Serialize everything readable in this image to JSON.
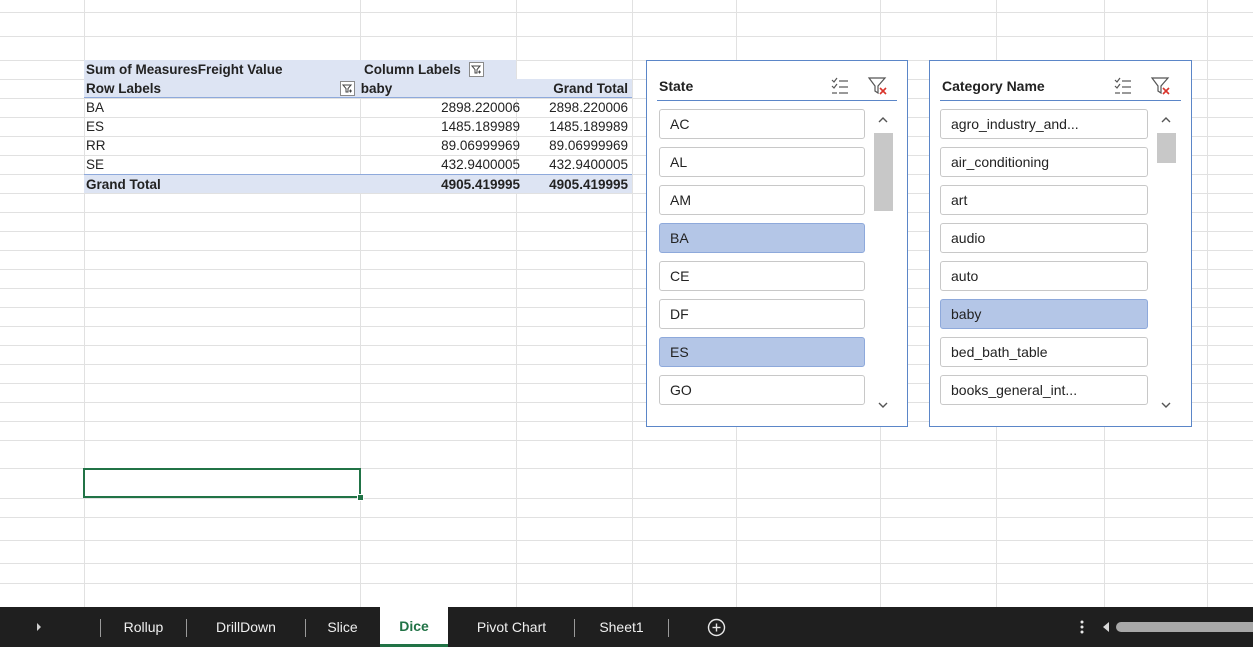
{
  "pivot": {
    "value_header": "Sum of MeasuresFreight Value",
    "column_labels_header": "Column Labels",
    "row_labels_header": "Row Labels",
    "column_item": "baby",
    "grand_total_col_header": "Grand Total",
    "rows": [
      {
        "label": "BA",
        "baby": "2898.220006",
        "grand_total": "2898.220006"
      },
      {
        "label": "ES",
        "baby": "1485.189989",
        "grand_total": "1485.189989"
      },
      {
        "label": "RR",
        "baby": "89.06999969",
        "grand_total": "89.06999969"
      },
      {
        "label": "SE",
        "baby": "432.9400005",
        "grand_total": "432.9400005"
      }
    ],
    "total": {
      "label": "Grand Total",
      "baby": "4905.419995",
      "grand_total": "4905.419995"
    }
  },
  "slicers": {
    "state": {
      "title": "State",
      "items": [
        {
          "label": "AC",
          "selected": false
        },
        {
          "label": "AL",
          "selected": false
        },
        {
          "label": "AM",
          "selected": false
        },
        {
          "label": "BA",
          "selected": true
        },
        {
          "label": "CE",
          "selected": false
        },
        {
          "label": "DF",
          "selected": false
        },
        {
          "label": "ES",
          "selected": true
        },
        {
          "label": "GO",
          "selected": false
        }
      ]
    },
    "category": {
      "title": "Category Name",
      "items": [
        {
          "label": "agro_industry_and...",
          "selected": false
        },
        {
          "label": "air_conditioning",
          "selected": false
        },
        {
          "label": "art",
          "selected": false
        },
        {
          "label": "audio",
          "selected": false
        },
        {
          "label": "auto",
          "selected": false
        },
        {
          "label": "baby",
          "selected": true
        },
        {
          "label": "bed_bath_table",
          "selected": false
        },
        {
          "label": "books_general_int...",
          "selected": false
        }
      ]
    },
    "selected_color": "#b4c6e7",
    "border_color": "#5b86c8"
  },
  "tabs": {
    "items": [
      "Rollup",
      "DrillDown",
      "Slice",
      "Dice",
      "Pivot Chart",
      "Sheet1"
    ],
    "active": "Dice",
    "active_color": "#217346"
  },
  "icons": {
    "filter_button": "filter-dropdown-icon",
    "multi_select": "multi-select-icon",
    "clear_filter": "clear-filter-icon",
    "add_sheet": "plus-circle-icon",
    "more": "vertical-ellipsis-icon"
  }
}
